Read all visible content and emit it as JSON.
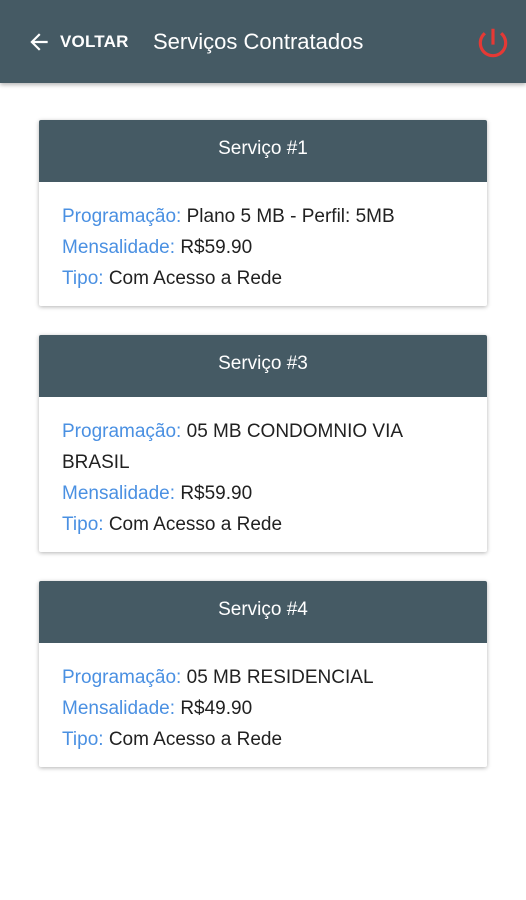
{
  "app_bar": {
    "back_label": "VOLTAR",
    "title": "Serviços Contratados",
    "back_icon": "arrow-left-icon",
    "power_icon": "power-icon",
    "power_color": "#e53935",
    "background_color": "#455a64"
  },
  "services": [
    {
      "header": "Serviço #1",
      "programacao_label": "Programação:",
      "programacao_value": "Plano 5 MB - Perfil: 5MB",
      "mensalidade_label": "Mensalidade:",
      "mensalidade_value": "R$59.90",
      "tipo_label": "Tipo:",
      "tipo_value": "Com Acesso a Rede"
    },
    {
      "header": "Serviço #3",
      "programacao_label": "Programação:",
      "programacao_value": "05 MB CONDOMNIO VIA BRASIL",
      "mensalidade_label": "Mensalidade:",
      "mensalidade_value": "R$59.90",
      "tipo_label": "Tipo:",
      "tipo_value": "Com Acesso a Rede"
    },
    {
      "header": "Serviço #4",
      "programacao_label": "Programação:",
      "programacao_value": "05 MB RESIDENCIAL",
      "mensalidade_label": "Mensalidade:",
      "mensalidade_value": "R$49.90",
      "tipo_label": "Tipo:",
      "tipo_value": "Com Acesso a Rede"
    }
  ],
  "colors": {
    "label": "#4a90e2",
    "value": "#212121",
    "card_header": "#455a64"
  }
}
